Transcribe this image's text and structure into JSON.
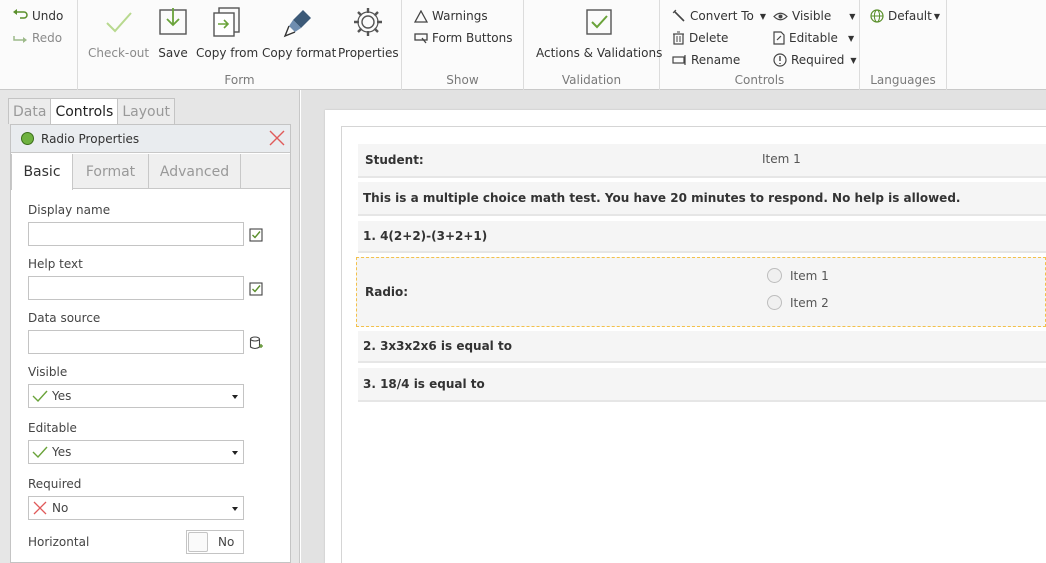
{
  "ribbon": {
    "undo": "Undo",
    "redo": "Redo",
    "form_group": {
      "label": "Form",
      "checkout": "Check-out",
      "save": "Save",
      "copy_from": "Copy from",
      "copy_format": "Copy format",
      "properties": "Properties"
    },
    "show_group": {
      "label": "Show",
      "warnings": "Warnings",
      "form_buttons": "Form Buttons"
    },
    "validation_group": {
      "label": "Validation",
      "actions": "Actions & Validations"
    },
    "controls_group": {
      "label": "Controls",
      "convert_to": "Convert To",
      "delete": "Delete",
      "rename": "Rename",
      "visible": "Visible",
      "editable": "Editable",
      "required": "Required"
    },
    "languages_group": {
      "label": "Languages",
      "default": "Default"
    }
  },
  "left_panel": {
    "tabs": [
      "Data",
      "Controls",
      "Layout"
    ],
    "active_tab": "Controls",
    "properties_title": "Radio Properties",
    "sub_tabs": [
      "Basic",
      "Format",
      "Advanced"
    ],
    "fields": {
      "display_name": {
        "label": "Display name",
        "value": ""
      },
      "help_text": {
        "label": "Help text",
        "value": ""
      },
      "data_source": {
        "label": "Data source",
        "value": ""
      },
      "visible": {
        "label": "Visible",
        "value": "Yes"
      },
      "editable": {
        "label": "Editable",
        "value": "Yes"
      },
      "required": {
        "label": "Required",
        "value": "No"
      },
      "horizontal": {
        "label": "Horizontal",
        "value": "No"
      }
    }
  },
  "form": {
    "student_label": "Student:",
    "student_value": "Item 1",
    "intro": "This is a multiple choice math test. You have 20 minutes to respond. No help is allowed.",
    "q1": "1. 4(2+2)-(3+2+1)",
    "radio_label": "Radio:",
    "radio_options": [
      "Item 1",
      "Item 2"
    ],
    "q2": "2. 3x3x2x6 is equal to",
    "q3": "3. 18/4 is equal to"
  },
  "colors": {
    "accent_green": "#8cc63f",
    "selection_outline": "#f3c14b",
    "close_red": "#e05a5a"
  }
}
